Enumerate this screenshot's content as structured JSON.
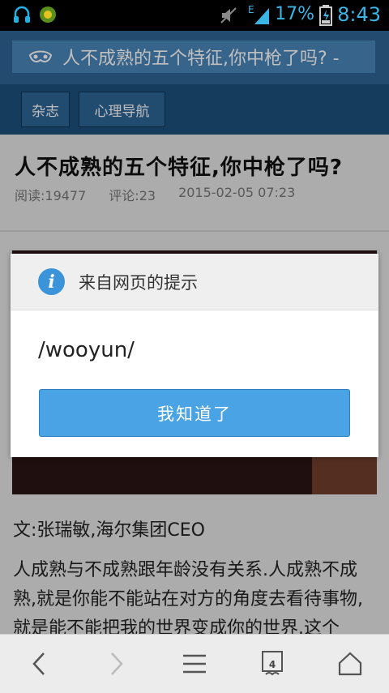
{
  "status_bar": {
    "network_type": "E",
    "battery_percent": "17%",
    "time": "8:43"
  },
  "address_bar": {
    "page_title": "人不成熟的五个特征,你中枪了吗? - "
  },
  "nav": {
    "items": [
      "杂志",
      "心理导航"
    ]
  },
  "article": {
    "title": "人不成熟的五个特征,你中枪了吗?",
    "reads": "阅读:19477",
    "comments": "评论:23",
    "datetime": "2015-02-05 07:23",
    "byline": "文:张瑞敏,海尔集团CEO",
    "body": "人成熟与不成熟跟年龄没有关系.人成熟不成熟,就是你能不能站在对方的角度去看待事物,就是能不能把我的世界变成你的世界.这个"
  },
  "dialog": {
    "title": "来自网页的提示",
    "message": "/wooyun/",
    "button_label": "我知道了"
  },
  "toolbar": {
    "tab_count": "4"
  },
  "colors": {
    "title_bar": "#2f6596",
    "nav_bar": "#1d4f7d",
    "dialog_button": "#49a3e5",
    "status_accent": "#3ab5e6"
  }
}
